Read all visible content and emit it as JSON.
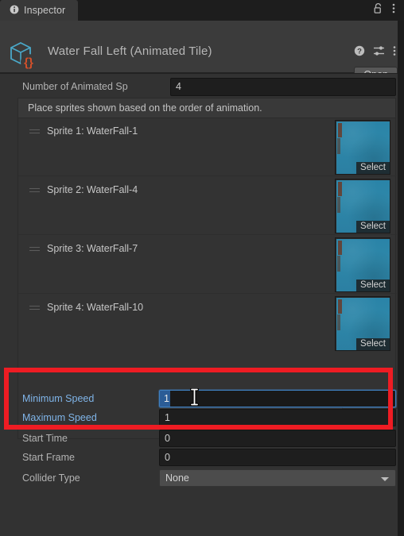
{
  "window": {
    "tab": {
      "label": "Inspector",
      "icon": "info-icon"
    },
    "tabbar_icons": [
      {
        "name": "lock-icon",
        "title": "Lock"
      },
      {
        "name": "kebab-menu-icon",
        "title": "More"
      }
    ]
  },
  "object_header": {
    "icon": "scriptable-object-cube-icon",
    "title": "Water Fall Left (Animated Tile)",
    "icons": [
      {
        "name": "help-icon",
        "title": "Help"
      },
      {
        "name": "preset-sliders-icon",
        "title": "Preset"
      },
      {
        "name": "kebab-menu-icon",
        "title": "More"
      }
    ],
    "open_label": "Open"
  },
  "main": {
    "count_field": {
      "label": "Number of Animated Sp",
      "full_label": "Number of Animated Sprites",
      "value": "4"
    },
    "help_text": "Place sprites shown based on the order of animation.",
    "sprites": [
      {
        "label": "Sprite 1: WaterFall-1",
        "select_label": "Select"
      },
      {
        "label": "Sprite 2: WaterFall-4",
        "select_label": "Select"
      },
      {
        "label": "Sprite 3: WaterFall-7",
        "select_label": "Select"
      },
      {
        "label": "Sprite 4: WaterFall-10",
        "select_label": "Select"
      }
    ],
    "properties": [
      {
        "label": "Minimum Speed",
        "value": "1",
        "type": "number",
        "focused": true,
        "highlighted": true
      },
      {
        "label": "Maximum Speed",
        "value": "1",
        "type": "number",
        "focused": false,
        "highlighted": true
      },
      {
        "label": "Start Time",
        "value": "0",
        "type": "number",
        "focused": false,
        "highlighted": false
      },
      {
        "label": "Start Frame",
        "value": "0",
        "type": "number",
        "focused": false,
        "highlighted": false
      },
      {
        "label": "Collider Type",
        "value": "None",
        "type": "dropdown",
        "focused": false,
        "highlighted": false
      }
    ]
  },
  "annotation": {
    "name": "red-highlight-box",
    "color": "#ee1c23",
    "targets": "Minimum Speed, Maximum Speed"
  },
  "colors": {
    "panel_bg": "#323232",
    "header_bg": "#3b3b3b",
    "tabbar_bg": "#1d1d1d",
    "field_bg": "#1e1e1e",
    "accent_blue": "#7fb4e8",
    "sprite_blue": "#2e87a9",
    "highlight_red": "#ee1c23"
  }
}
